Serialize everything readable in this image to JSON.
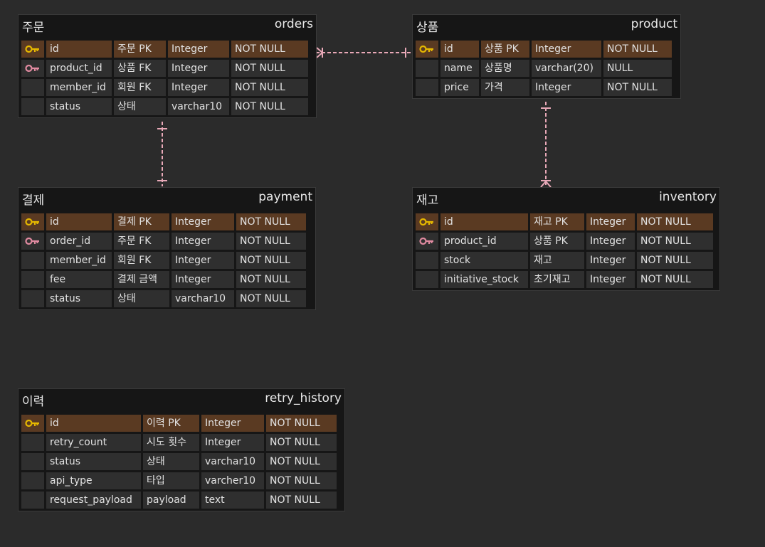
{
  "colors": {
    "background": "#2b2b2b",
    "table_bg": "#161616",
    "cell_bg": "#2f2f2f",
    "pk_row_bg": "#5a3a22",
    "pk_key": "#e6b800",
    "fk_key": "#e08aa0",
    "connector": "#e9a9b8"
  },
  "tables": {
    "orders": {
      "korean": "주문",
      "english": "orders",
      "rows": [
        {
          "key": "pk",
          "field": "id",
          "desc": "주문 PK",
          "type": "Integer",
          "null": "NOT NULL"
        },
        {
          "key": "fk",
          "field": "product_id",
          "desc": "상품 FK",
          "type": "Integer",
          "null": "NOT NULL"
        },
        {
          "key": "",
          "field": "member_id",
          "desc": "회원 FK",
          "type": "Integer",
          "null": "NOT NULL"
        },
        {
          "key": "",
          "field": "status",
          "desc": "상태",
          "type": "varchar10",
          "null": "NOT NULL"
        }
      ]
    },
    "product": {
      "korean": "상품",
      "english": "product",
      "rows": [
        {
          "key": "pk",
          "field": "id",
          "desc": "상품 PK",
          "type": "Integer",
          "null": "NOT NULL"
        },
        {
          "key": "",
          "field": "name",
          "desc": "상품명",
          "type": "varchar(20)",
          "null": "NULL"
        },
        {
          "key": "",
          "field": "price",
          "desc": "가격",
          "type": "Integer",
          "null": "NOT NULL"
        }
      ]
    },
    "payment": {
      "korean": "결제",
      "english": "payment",
      "rows": [
        {
          "key": "pk",
          "field": "id",
          "desc": "결제 PK",
          "type": "Integer",
          "null": "NOT NULL"
        },
        {
          "key": "fk",
          "field": "order_id",
          "desc": "주문 FK",
          "type": "Integer",
          "null": "NOT NULL"
        },
        {
          "key": "",
          "field": "member_id",
          "desc": "회원 FK",
          "type": "Integer",
          "null": "NOT NULL"
        },
        {
          "key": "",
          "field": "fee",
          "desc": "결제 금액",
          "type": "Integer",
          "null": "NOT NULL"
        },
        {
          "key": "",
          "field": "status",
          "desc": "상태",
          "type": "varchar10",
          "null": "NOT NULL"
        }
      ]
    },
    "inventory": {
      "korean": "재고",
      "english": "inventory",
      "rows": [
        {
          "key": "pk",
          "field": "id",
          "desc": "재고 PK",
          "type": "Integer",
          "null": "NOT NULL"
        },
        {
          "key": "fk",
          "field": "product_id",
          "desc": "상품 PK",
          "type": "Integer",
          "null": "NOT NULL"
        },
        {
          "key": "",
          "field": "stock",
          "desc": "재고",
          "type": "Integer",
          "null": "NOT NULL"
        },
        {
          "key": "",
          "field": "initiative_stock",
          "desc": "초기재고",
          "type": "Integer",
          "null": "NOT NULL"
        }
      ]
    },
    "retry_history": {
      "korean": "이력",
      "english": "retry_history",
      "rows": [
        {
          "key": "pk",
          "field": "id",
          "desc": "이력 PK",
          "type": "Integer",
          "null": "NOT NULL"
        },
        {
          "key": "",
          "field": "retry_count",
          "desc": "시도 횟수",
          "type": "Integer",
          "null": "NOT NULL"
        },
        {
          "key": "",
          "field": "status",
          "desc": "상태",
          "type": "varchar10",
          "null": "NOT NULL"
        },
        {
          "key": "",
          "field": "api_type",
          "desc": "타입",
          "type": "varcher10",
          "null": "NOT NULL"
        },
        {
          "key": "",
          "field": "request_payload",
          "desc": "payload",
          "type": "text",
          "null": "NOT NULL"
        }
      ]
    }
  },
  "relations": [
    {
      "from": "orders",
      "to": "product",
      "from_end": "many",
      "to_end": "one"
    },
    {
      "from": "orders",
      "to": "payment",
      "from_end": "one",
      "to_end": "one"
    },
    {
      "from": "product",
      "to": "inventory",
      "from_end": "one",
      "to_end": "many"
    }
  ]
}
